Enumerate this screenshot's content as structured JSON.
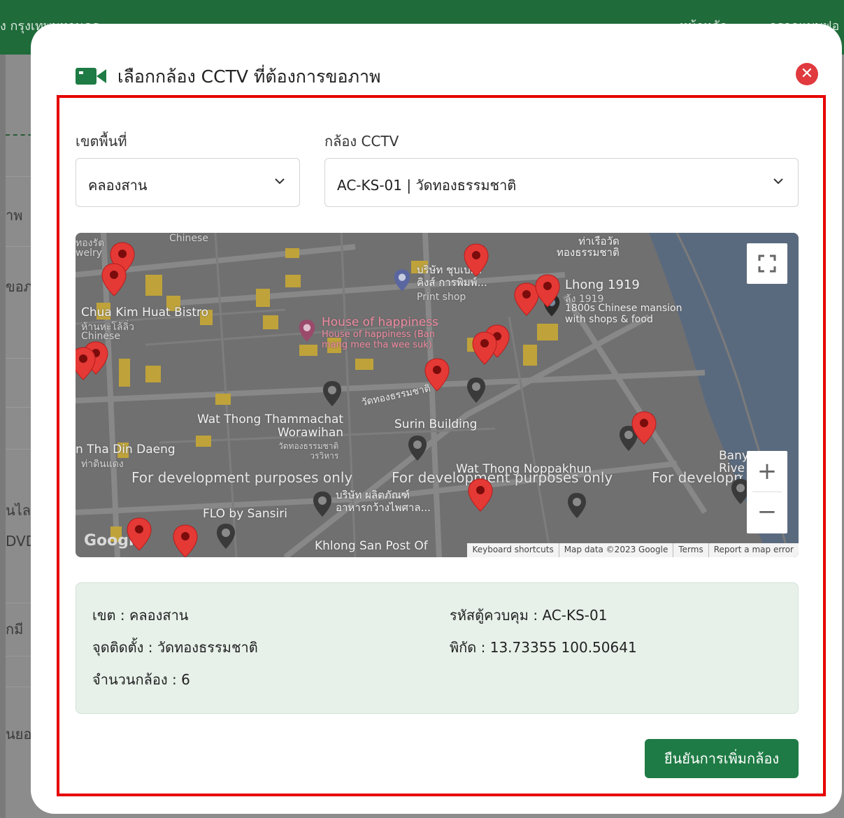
{
  "background": {
    "header_left": "ง กรุงเทพมหานคร",
    "header_right_1": "หน้าหลัก",
    "header_right_2": "กรอกแบบฟอ",
    "fragments": [
      "าพ",
      "ขอภ",
      "นไล",
      "DVD",
      "กมี",
      "นยอ"
    ]
  },
  "modal": {
    "title": "เลือกกล้อง CCTV ที่ต้องการขอภาพ",
    "icons": {
      "title": "video-camera-icon",
      "close": "close-icon"
    },
    "district": {
      "label": "เขตพื้นที่",
      "value": "คลองสาน"
    },
    "camera": {
      "label": "กล้อง CCTV",
      "value": "AC-KS-01 | วัดทองธรรมชาติ"
    },
    "map": {
      "labels": {
        "chinese_1": "Chinese",
        "jewelry": "ทองรัต\nwelry",
        "cha_kim": "Chua Kim Huat Bistro",
        "cha_kim_th": "ห้านหะโล้ลิ่ว",
        "chinese_2": "Chinese",
        "house": "House of happiness",
        "house_sub": "House of happiness (Ban\nmang mee tha wee suk)",
        "company": "บริษัท ชุบเปอร์\nคิงส์ การพิมพ์...",
        "print_shop": "Print shop",
        "pier": "ท่าเรือวัด\nทองธรรมชาติ",
        "lhong": "Lhong 1919",
        "lhong_th": "ล้ง 1919",
        "lhong_desc": "1800s Chinese mansion\nwith shops & food",
        "wat_road": "วัดทองธรรมชาติ",
        "wat_thong": "Wat Thong Thammachat\nWorawihan",
        "wat_thong_th": "วัดทองธรรมชาติ\nวรวิหาร",
        "surin": "Surin Building",
        "tha_din": "n Tha Din Daeng",
        "tha_din_th": "ท่าดินแดง",
        "noppakhun": "Wat Thong Noppakhun",
        "food_co": "บริษัท ผลิตภัณฑ์\nอาหารกว้างไพศาล...",
        "flo": "FLO by Sansiri",
        "post": "Khlong San Post Of",
        "bany": "Bany\nRive",
        "dev": "For development purposes only",
        "google": "Google"
      },
      "attribution": [
        "Keyboard shortcuts",
        "Map data ©2023 Google",
        "Terms",
        "Report a map error"
      ],
      "zoom_in": "+",
      "zoom_out": "−",
      "icons": {
        "fullscreen": "fullscreen-icon",
        "pin": "map-pin-icon",
        "place": "place-marker-icon"
      }
    },
    "info": {
      "district": "เขต : คลองสาน",
      "location": "จุดติดตั้ง : วัดทองธรรมชาติ",
      "camera_count": "จำนวนกล้อง : 6",
      "control_code": "รหัสตู้ควบคุม : AC-KS-01",
      "coords": "พิกัด : 13.73355 100.50641"
    },
    "confirm_label": "ยืนยันการเพิ่มกล้อง"
  }
}
